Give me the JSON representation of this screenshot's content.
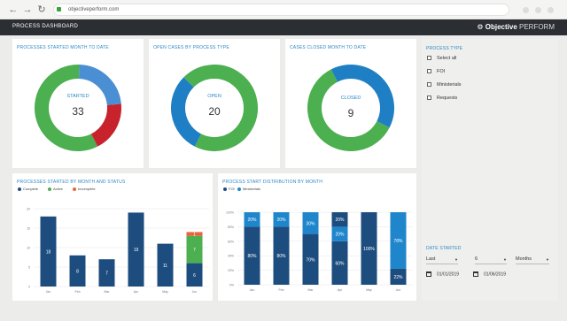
{
  "browser": {
    "url": "objectiveperform.com"
  },
  "header": {
    "title": "PROCESS DASHBOARD",
    "brand_bold": "Objective",
    "brand_light": "PERFORM"
  },
  "cards": {
    "started": {
      "title": "PROCESSES STARTED MONTH TO DATE",
      "center_label": "STARTED",
      "center_value": "33"
    },
    "open": {
      "title": "OPEN CASES BY PROCESS TYPE",
      "center_label": "OPEN",
      "center_value": "20"
    },
    "closed": {
      "title": "CASES CLOSED MONTH TO DATE",
      "center_label": "CLOSED",
      "center_value": "9"
    }
  },
  "colors": {
    "navy": "#1d4d7e",
    "blue": "#2a88c4",
    "green": "#4caf50",
    "red": "#c8232c",
    "orange": "#e8643a",
    "lightblue": "#4a90e2"
  },
  "chart_data": [
    {
      "type": "pie",
      "title": "PROCESSES STARTED MONTH TO DATE",
      "labels": [
        "",
        "",
        ""
      ],
      "values": [
        58,
        23,
        19
      ],
      "colors": [
        "#4caf50",
        "#4a8fd4",
        "#c8232c"
      ]
    },
    {
      "type": "pie",
      "title": "OPEN CASES BY PROCESS TYPE",
      "labels": [
        "",
        ""
      ],
      "values": [
        70,
        30
      ],
      "colors": [
        "#4caf50",
        "#1f7fc4"
      ]
    },
    {
      "type": "pie",
      "title": "CASES CLOSED MONTH TO DATE",
      "labels": [
        "",
        ""
      ],
      "values": [
        60,
        40
      ],
      "colors": [
        "#4caf50",
        "#1f7fc4"
      ]
    },
    {
      "type": "bar",
      "title": "PROCESSES STARTED BY MONTH AND STATUS",
      "categories": [
        "Jan",
        "Feb",
        "Mar",
        "Apr",
        "May",
        "Jun"
      ],
      "series": [
        {
          "name": "Complete",
          "color": "#1d4d7e",
          "values": [
            18,
            8,
            7,
            19,
            11,
            6
          ]
        },
        {
          "name": "Active",
          "color": "#4caf50",
          "values": [
            0,
            0,
            0,
            0,
            0,
            7
          ]
        },
        {
          "name": "Incomplete",
          "color": "#e8643a",
          "values": [
            0,
            0,
            0,
            0,
            0,
            1
          ]
        }
      ],
      "data_labels": [
        [
          "18",
          "8",
          "7",
          "19",
          "11",
          "6"
        ],
        [
          "",
          "",
          "",
          "",
          "",
          "7"
        ],
        [
          "",
          "",
          "",
          "",
          "",
          "1"
        ]
      ],
      "yticks": [
        0,
        5,
        10,
        15,
        20
      ],
      "ylim": [
        0,
        20
      ]
    },
    {
      "type": "bar",
      "title": "PROCESS START DISTRIBUTION BY MONTH",
      "categories": [
        "Jan",
        "Feb",
        "Mar",
        "Apr",
        "May",
        "Jun"
      ],
      "series": [
        {
          "name": "FOI",
          "color": "#1d4d7e",
          "values": [
            80,
            80,
            70,
            60,
            100,
            22
          ]
        },
        {
          "name": "Ministerials",
          "color": "#1f86cc",
          "values": [
            20,
            20,
            30,
            20,
            0,
            78
          ]
        },
        {
          "name": "",
          "color": "#1d4d7e",
          "values": [
            0,
            0,
            0,
            20,
            0,
            0
          ]
        }
      ],
      "data_labels": [
        [
          "80%",
          "80%",
          "70%",
          "60%",
          "100%",
          "22%"
        ],
        [
          "20%",
          "20%",
          "30%",
          "20%",
          "",
          "78%"
        ],
        [
          "",
          "",
          "",
          "20%",
          "",
          ""
        ]
      ],
      "yticks": [
        "0%",
        "20%",
        "40%",
        "60%",
        "80%",
        "100%"
      ],
      "ylim": [
        0,
        100
      ]
    }
  ],
  "filters": {
    "process_type_title": "PROCESS TYPE",
    "options": [
      "Select all",
      "FOI",
      "Ministerials",
      "Requests"
    ],
    "date_title": "DATE STARTED",
    "period_value": "Last",
    "count_value": "6",
    "unit_value": "Months",
    "date_from": "01/01/2019",
    "date_to": "01/06/2019"
  }
}
